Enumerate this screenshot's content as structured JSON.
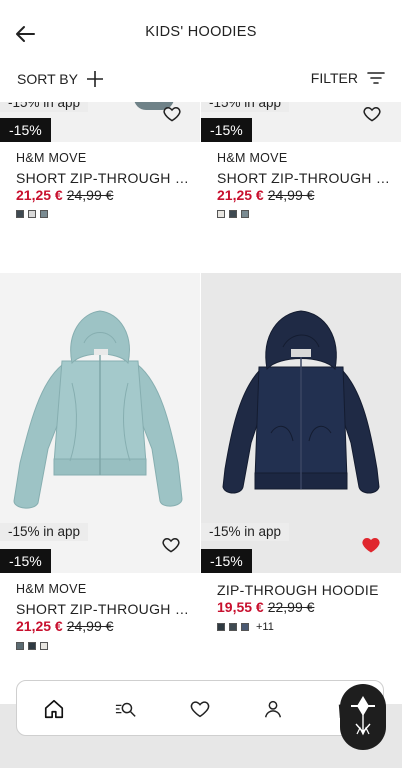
{
  "header": {
    "title": "KIDS' HOODIES"
  },
  "controls": {
    "sort_label": "SORT BY",
    "filter_label": "FILTER"
  },
  "products": [
    {
      "promo": "-15% in app",
      "discount": "-15%",
      "brand": "H&M MOVE",
      "name": "SHORT ZIP-THROUGH HOODIE",
      "price_now": "21,25 €",
      "price_old": "24,99 €",
      "favorited": false,
      "swatches": [
        "#3f4a52",
        "#d9d9d9",
        "#7a8b92"
      ]
    },
    {
      "promo": "-15% in app",
      "discount": "-15%",
      "brand": "H&M MOVE",
      "name": "SHORT ZIP-THROUGH HOODIE",
      "price_now": "21,25 €",
      "price_old": "24,99 €",
      "favorited": false,
      "swatches": [
        "#e8e6e1",
        "#3f4a52",
        "#7a8b92"
      ]
    },
    {
      "promo": "-15% in app",
      "discount": "-15%",
      "brand": "H&M MOVE",
      "name": "SHORT ZIP-THROUGH HOODIE",
      "price_now": "21,25 €",
      "price_old": "24,99 €",
      "favorited": false,
      "swatches": [
        "#5b6b72",
        "#2f3a42",
        "#e8e6e1"
      ]
    },
    {
      "promo": "-15% in app",
      "discount": "-15%",
      "brand": "",
      "name": "ZIP-THROUGH HOODIE",
      "price_now": "19,55 €",
      "price_old": "22,99 €",
      "favorited": true,
      "swatches": [
        "#2f3a42",
        "#3f4a52",
        "#4b5a73"
      ],
      "more_colors": "+11"
    }
  ],
  "nav": [
    "home",
    "search",
    "favourites",
    "account",
    "bag"
  ],
  "colors": {
    "sale_red": "#c8102e",
    "heart_active": "#e0272e",
    "badge_black": "#111111"
  }
}
